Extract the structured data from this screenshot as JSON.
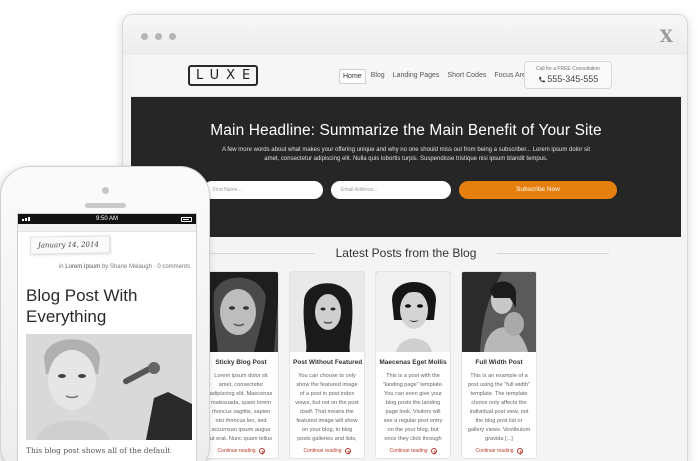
{
  "site": {
    "logo": "LUXE",
    "nav": [
      "Home",
      "Blog",
      "Landing Pages",
      "Short Codes",
      "Focus Areas"
    ],
    "phone_label": "Call for a FREE Consultation",
    "phone_number": "555-345-555"
  },
  "hero": {
    "headline": "Main Headline: Summarize the Main Benefit of Your Site",
    "subtext": "A few more words about what makes your offering unique and why no one should miss out from being a subscriber... Lorem ipsum dolor sit amet, consectetur adipiscing elit. Nulla quis lobortis turpis. Suspendisse tristique nisi ipsum blandit tempus.",
    "first_name_placeholder": "First Name...",
    "email_placeholder": "Email Address...",
    "subscribe_label": "Subscribe Now"
  },
  "latest": {
    "heading": "Latest Posts from the Blog",
    "read_more": "Continue reading",
    "posts": [
      {
        "title": "Sticky Blog Post",
        "excerpt": "Lorem ipsum dolor sit amet, consectetur adipiscing elit. Maecenas malesuada, quam lorem rhoncus sagittis, sapien nisi rhoncus leo, sed accumsan ipsum augue ut erat. Nunc quam tellus a sem. Maecenas eget dictum dui [...]"
      },
      {
        "title": "Post Without Featured I...",
        "excerpt": "You can choose to only show the featured image of a post in post index views, but not on the post itself. That means the featured image will show on your blog, in blog posts galleries and lists, but not [...]"
      },
      {
        "title": "Maecenas Eget Mollis",
        "excerpt": "This is a post with the \"landing page\" template. You can even give your blog posts the landing page look. Visitors will see a regular post entry on the your blog, but once they click through [...]"
      },
      {
        "title": "Full Width Post",
        "excerpt": "This is an example of a post using the \"full width\" template. The template choice only affects the individual post view, not the blog post list or gallery views. Vestibulum gravida [...]"
      }
    ]
  },
  "phone": {
    "time": "9:50 AM",
    "date": "January 14, 2014",
    "byline_in": "in",
    "byline_category": "Lorem Ipsum",
    "byline_by": "by Shane Melaugh",
    "byline_comments": "0 comments",
    "post_title_line1": "Blog Post With",
    "post_title_line2": "Everything",
    "post_text": "This blog post shows all of the default"
  },
  "colors": {
    "accent": "#e57f0e",
    "hero_bg": "#262626",
    "link": "#c0392b"
  }
}
